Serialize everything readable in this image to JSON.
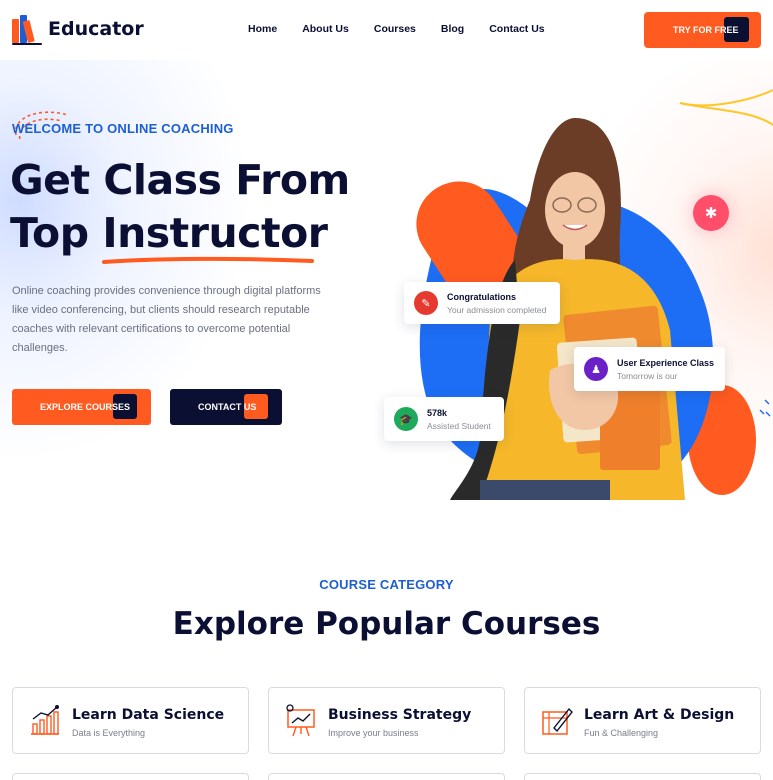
{
  "header": {
    "logo_text": "Educator",
    "nav": [
      "Home",
      "About Us",
      "Courses",
      "Blog",
      "Contact Us"
    ],
    "cta_label": "TRY FOR FREE"
  },
  "hero": {
    "eyebrow": "WELCOME TO ONLINE COACHING",
    "title_line1": "Get Class From",
    "title_line2_plain": "Top ",
    "title_line2_highlight": "Instructor",
    "description": "Online coaching provides convenience through digital platforms like video conferencing, but clients should research reputable coaches with relevant certifications to overcome potential challenges.",
    "primary_button": "EXPLORE COURSES",
    "secondary_button": "CONTACT US",
    "cards": {
      "congrats_title": "Congratulations",
      "congrats_sub": "Your admission completed",
      "ux_title": "User Experience Class",
      "ux_sub": "Tomorrow is our",
      "students_count": "578k",
      "students_label": "Assisted Student"
    }
  },
  "courses": {
    "eyebrow": "COURSE CATEGORY",
    "title": "Explore Popular Courses",
    "items": [
      {
        "name": "Learn Data Science",
        "sub": "Data is Everything",
        "icon": "chart-icon"
      },
      {
        "name": "Business Strategy",
        "sub": "Improve your business",
        "icon": "presentation-icon"
      },
      {
        "name": "Learn Art & Design",
        "sub": "Fun & Challenging",
        "icon": "design-icon"
      }
    ]
  },
  "colors": {
    "accent": "#ff5a1f",
    "navy": "#0b1033",
    "blue": "#1d5fd3"
  }
}
